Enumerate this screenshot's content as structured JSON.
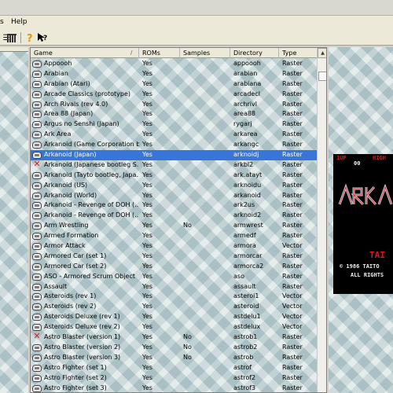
{
  "menu": {
    "help": "Help",
    "partial": "s"
  },
  "list": {
    "headers": {
      "game": "Game",
      "roms": "ROMs",
      "samples": "Samples",
      "directory": "Directory",
      "type": "Type"
    },
    "rows": [
      {
        "game": "Appoooh",
        "roms": "Yes",
        "samples": "",
        "dir": "appoooh",
        "type": "Raster",
        "icon": "ok"
      },
      {
        "game": "Arabian",
        "roms": "Yes",
        "samples": "",
        "dir": "arabian",
        "type": "Raster",
        "icon": "ok"
      },
      {
        "game": "Arabian (Atari)",
        "roms": "Yes",
        "samples": "",
        "dir": "arabiana",
        "type": "Raster",
        "icon": "ok"
      },
      {
        "game": "Arcade Classics (prototype)",
        "roms": "Yes",
        "samples": "",
        "dir": "arcadecl",
        "type": "Raster",
        "icon": "ok"
      },
      {
        "game": "Arch Rivals (rev 4.0)",
        "roms": "Yes",
        "samples": "",
        "dir": "archrivl",
        "type": "Raster",
        "icon": "ok"
      },
      {
        "game": "Area 88 (Japan)",
        "roms": "Yes",
        "samples": "",
        "dir": "area88",
        "type": "Raster",
        "icon": "ok"
      },
      {
        "game": "Argus no Senshi (Japan)",
        "roms": "Yes",
        "samples": "",
        "dir": "rygarj",
        "type": "Raster",
        "icon": "ok"
      },
      {
        "game": "Ark Area",
        "roms": "Yes",
        "samples": "",
        "dir": "arkarea",
        "type": "Raster",
        "icon": "ok"
      },
      {
        "game": "Arkanoid (Game Corporation b...",
        "roms": "Yes",
        "samples": "",
        "dir": "arkangc",
        "type": "Raster",
        "icon": "ok"
      },
      {
        "game": "Arkanoid (Japan)",
        "roms": "Yes",
        "samples": "",
        "dir": "arknoidj",
        "type": "Raster",
        "icon": "ok",
        "selected": true
      },
      {
        "game": "Arkanoid (Japanese bootleg S...",
        "roms": "Yes",
        "samples": "",
        "dir": "arkbl2",
        "type": "Raster",
        "icon": "missing"
      },
      {
        "game": "Arkanoid (Tayto bootleg, Japa...",
        "roms": "Yes",
        "samples": "",
        "dir": "ark.atayt",
        "type": "Raster",
        "icon": "ok"
      },
      {
        "game": "Arkanoid (US)",
        "roms": "Yes",
        "samples": "",
        "dir": "arknoidu",
        "type": "Raster",
        "icon": "ok"
      },
      {
        "game": "Arkanoid (World)",
        "roms": "Yes",
        "samples": "",
        "dir": "arkanoid",
        "type": "Raster",
        "icon": "ok"
      },
      {
        "game": "Arkanoid - Revenge of DOH (...",
        "roms": "Yes",
        "samples": "",
        "dir": "ark2us",
        "type": "Raster",
        "icon": "ok"
      },
      {
        "game": "Arkanoid - Revenge of DOH (...",
        "roms": "Yes",
        "samples": "",
        "dir": "arknoid2",
        "type": "Raster",
        "icon": "ok"
      },
      {
        "game": "Arm Wrestling",
        "roms": "Yes",
        "samples": "No",
        "dir": "armwrest",
        "type": "Raster",
        "icon": "ok"
      },
      {
        "game": "Armed Formation",
        "roms": "Yes",
        "samples": "",
        "dir": "armedf",
        "type": "Raster",
        "icon": "ok"
      },
      {
        "game": "Armor Attack",
        "roms": "Yes",
        "samples": "",
        "dir": "armora",
        "type": "Vector",
        "icon": "ok"
      },
      {
        "game": "Armored Car (set 1)",
        "roms": "Yes",
        "samples": "",
        "dir": "armorcar",
        "type": "Raster",
        "icon": "ok"
      },
      {
        "game": "Armored Car (set 2)",
        "roms": "Yes",
        "samples": "",
        "dir": "armorca2",
        "type": "Raster",
        "icon": "ok"
      },
      {
        "game": "ASO - Armored Scrum Object",
        "roms": "Yes",
        "samples": "",
        "dir": "aso",
        "type": "Raster",
        "icon": "ok"
      },
      {
        "game": "Assault",
        "roms": "Yes",
        "samples": "",
        "dir": "assault",
        "type": "Raster",
        "icon": "ok"
      },
      {
        "game": "Asteroids (rev 1)",
        "roms": "Yes",
        "samples": "",
        "dir": "asteroi1",
        "type": "Vector",
        "icon": "ok"
      },
      {
        "game": "Asteroids (rev 2)",
        "roms": "Yes",
        "samples": "",
        "dir": "asteroid",
        "type": "Vector",
        "icon": "ok"
      },
      {
        "game": "Asteroids Deluxe (rev 1)",
        "roms": "Yes",
        "samples": "",
        "dir": "astdelu1",
        "type": "Vector",
        "icon": "ok"
      },
      {
        "game": "Asteroids Deluxe (rev 2)",
        "roms": "Yes",
        "samples": "",
        "dir": "astdelux",
        "type": "Vector",
        "icon": "ok"
      },
      {
        "game": "Astro Blaster (version 1)",
        "roms": "Yes",
        "samples": "No",
        "dir": "astrob1",
        "type": "Raster",
        "icon": "missing"
      },
      {
        "game": "Astro Blaster (version 2)",
        "roms": "Yes",
        "samples": "No",
        "dir": "astrob2",
        "type": "Raster",
        "icon": "ok"
      },
      {
        "game": "Astro Blaster (version 3)",
        "roms": "Yes",
        "samples": "No",
        "dir": "astrob",
        "type": "Raster",
        "icon": "ok"
      },
      {
        "game": "Astro Fighter (set 1)",
        "roms": "Yes",
        "samples": "",
        "dir": "astrof",
        "type": "Raster",
        "icon": "ok"
      },
      {
        "game": "Astro Fighter (set 2)",
        "roms": "Yes",
        "samples": "",
        "dir": "astrof2",
        "type": "Raster",
        "icon": "ok"
      },
      {
        "game": "Astro Fighter (set 3)",
        "roms": "Yes",
        "samples": "",
        "dir": "astrof3",
        "type": "Raster",
        "icon": "ok"
      }
    ]
  },
  "snapshot": {
    "hud_left": "1UP",
    "hud_right": "HIGH",
    "score": "00",
    "brand": "TAI",
    "copyright_line": "© 1986 TAITO",
    "rights_line": "ALL RIGHTS",
    "hud_color": "#e01818",
    "text_color": "#f0f0f0"
  },
  "colors": {
    "selection": "#3875d6",
    "missing_mark": "#e02020"
  }
}
